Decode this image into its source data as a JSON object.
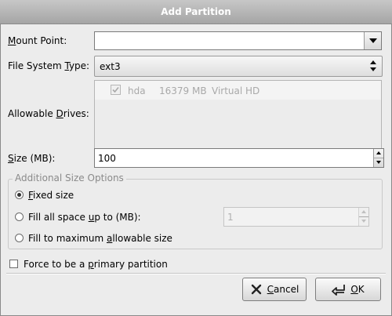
{
  "window": {
    "title": "Add Partition"
  },
  "mount_point": {
    "label": "Mount Point:",
    "value": ""
  },
  "fs_type": {
    "label": "File System Type:",
    "value": "ext3"
  },
  "drives": {
    "label": "Allowable Drives:",
    "rows": [
      {
        "checked": true,
        "name": "hda",
        "size": "16379 MB",
        "model": "Virtual HD"
      }
    ]
  },
  "size": {
    "label": "Size (MB):",
    "value": "100"
  },
  "additional": {
    "legend": "Additional Size Options",
    "fixed_label": "Fixed size",
    "fill_upto_label": "Fill all space up to (MB):",
    "fill_upto_value": "1",
    "fill_max_label": "Fill to maximum allowable size",
    "selected": "fixed"
  },
  "force_primary": {
    "label": "Force to be a primary partition",
    "checked": false
  },
  "buttons": {
    "cancel": "Cancel",
    "ok": "OK"
  }
}
